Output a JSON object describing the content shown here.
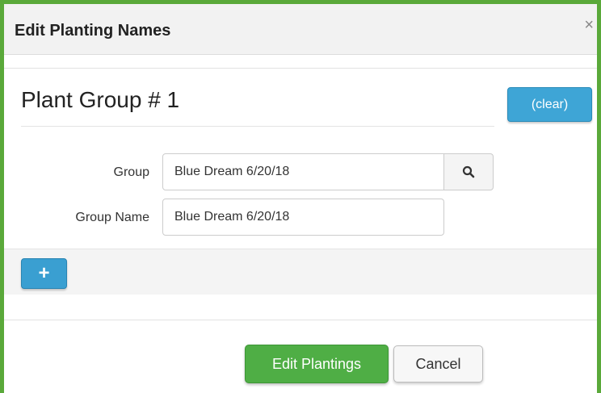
{
  "dialog": {
    "title": "Edit Planting Names",
    "close_glyph": "×"
  },
  "plant_group": {
    "heading": "Plant Group # 1",
    "clear_label": "(clear)",
    "fields": {
      "group_label": "Group",
      "group_value": "Blue Dream 6/20/18",
      "group_name_label": "Group Name",
      "group_name_value": "Blue Dream 6/20/18"
    },
    "search_icon": "search-icon"
  },
  "actions": {
    "add_glyph": "+",
    "primary_label": "Edit Plantings",
    "cancel_label": "Cancel"
  },
  "colors": {
    "frame_border": "#5aa93a",
    "info_button": "#3ea5d6",
    "success_button": "#4fae45"
  }
}
